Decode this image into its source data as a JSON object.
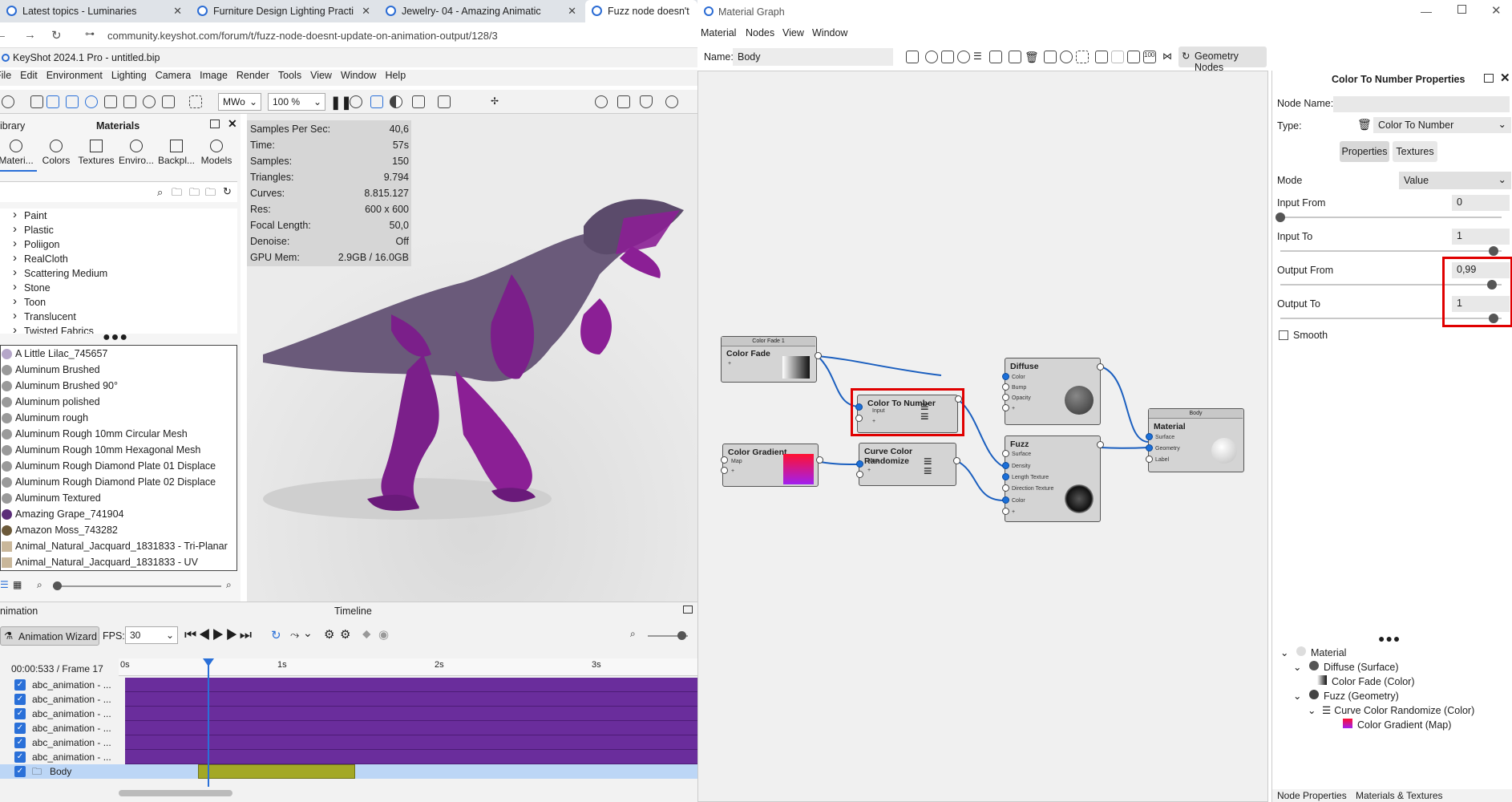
{
  "browser": {
    "tabs": [
      "Latest topics - Luminaries",
      "Furniture Design Lighting Practi",
      "Jewelry- 04 - Amazing Animatic",
      "Fuzz node doesn't"
    ],
    "url": "community.keyshot.com/forum/t/fuzz-node-doesnt-update-on-animation-output/128/3"
  },
  "keyshot": {
    "title": "KeyShot 2024.1 Pro  - untitled.bip",
    "menu": [
      "File",
      "Edit",
      "Environment",
      "Lighting",
      "Camera",
      "Image",
      "Render",
      "Tools",
      "View",
      "Window",
      "Help"
    ],
    "toolbar": {
      "mode": "MWo",
      "zoom": "100 %"
    },
    "library": {
      "left_label": "ibrary",
      "title": "Materials",
      "tabs": [
        "Materi...",
        "Colors",
        "Textures",
        "Enviro...",
        "Backpl...",
        "Models"
      ],
      "tree": [
        "Paint",
        "Plastic",
        "Poliigon",
        "RealCloth",
        "Scattering Medium",
        "Stone",
        "Toon",
        "Translucent",
        "Twisted Fabrics"
      ],
      "materials": [
        "A Little Lilac_745657",
        "Aluminum Brushed",
        "Aluminum Brushed 90°",
        "Aluminum polished",
        "Aluminum rough",
        "Aluminum Rough 10mm Circular Mesh",
        "Aluminum Rough 10mm Hexagonal Mesh",
        "Aluminum Rough Diamond Plate 01 Displace",
        "Aluminum Rough Diamond Plate 02 Displace",
        "Aluminum Textured",
        "Amazing Grape_741904",
        "Amazon Moss_743282",
        "Animal_Natural_Jacquard_1831833 - Tri-Planar",
        "Animal_Natural_Jacquard_1831833 - UV"
      ]
    },
    "stats": [
      [
        "Samples Per Sec:",
        "40,6"
      ],
      [
        "Time:",
        "57s"
      ],
      [
        "Samples:",
        "150"
      ],
      [
        "Triangles:",
        "9.794"
      ],
      [
        "Curves:",
        "8.815.127"
      ],
      [
        "Res:",
        "600 x 600"
      ],
      [
        "Focal Length:",
        "50,0"
      ],
      [
        "Denoise:",
        "Off"
      ],
      [
        "GPU Mem:",
        "2.9GB / 16.0GB"
      ]
    ],
    "animation": {
      "left_label": "nimation",
      "title": "Timeline",
      "wizard": "Animation Wizard",
      "fps_label": "FPS:",
      "fps": "30",
      "time": "00:00:533 / Frame 17",
      "ticks": [
        "0s",
        "1s",
        "2s",
        "3s"
      ],
      "tracks": [
        "abc_animation - ...",
        "abc_animation - ...",
        "abc_animation - ...",
        "abc_animation - ...",
        "abc_animation - ...",
        "abc_animation - ...",
        "Body"
      ]
    }
  },
  "graph": {
    "title": "Material Graph",
    "menu": [
      "Material",
      "Nodes",
      "View",
      "Window"
    ],
    "name_label": "Name:",
    "name_value": "Body",
    "geometry_nodes": "Geometry Nodes",
    "nodes": {
      "color_fade": {
        "header": "Color Fade 1",
        "title": "Color Fade",
        "ports": [
          "+"
        ]
      },
      "color_to_number": {
        "title": "Color To Number",
        "ports": [
          "Input",
          "+"
        ]
      },
      "color_gradient": {
        "title": "Color Gradient",
        "ports": [
          "Map",
          "+"
        ]
      },
      "curve_color": {
        "title": "Curve Color Randomize",
        "ports": [
          "Map",
          "+"
        ]
      },
      "diffuse": {
        "title": "Diffuse",
        "ports": [
          "Color",
          "Bump",
          "Opacity",
          "+"
        ]
      },
      "fuzz": {
        "title": "Fuzz",
        "ports": [
          "Surface",
          "Density",
          "Length Texture",
          "Direction Texture",
          "Color",
          "+"
        ]
      },
      "material": {
        "header": "Body",
        "title": "Material",
        "ports": [
          "Surface",
          "Geometry",
          "Label"
        ]
      }
    }
  },
  "properties": {
    "title": "Color To Number Properties",
    "node_name_label": "Node Name:",
    "type_label": "Type:",
    "type_value": "Color To Number",
    "tabs": [
      "Properties",
      "Textures"
    ],
    "mode_label": "Mode",
    "mode_value": "Value",
    "input_from_label": "Input From",
    "input_from": "0",
    "input_to_label": "Input To",
    "input_to": "1",
    "output_from_label": "Output From",
    "output_from": "0,99",
    "output_to_label": "Output To",
    "output_to": "1",
    "smooth_label": "Smooth",
    "tree": [
      "Material",
      "Diffuse (Surface)",
      "Color Fade (Color)",
      "Fuzz (Geometry)",
      "Curve Color Randomize (Color)",
      "Color Gradient (Map)"
    ],
    "bottom_tabs": [
      "Node Properties",
      "Materials & Textures"
    ]
  }
}
